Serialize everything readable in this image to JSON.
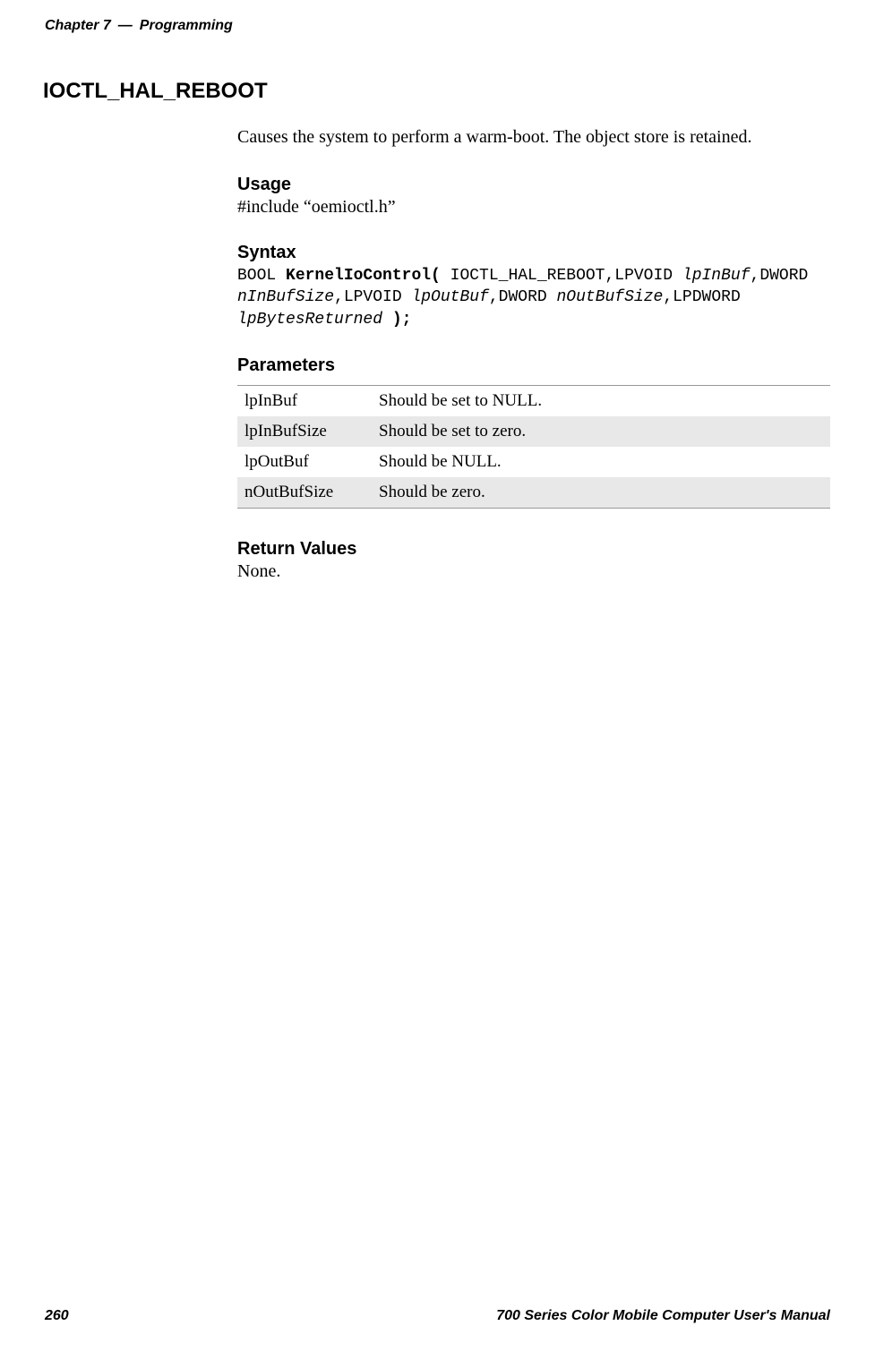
{
  "header": {
    "chapter_label": "Chapter 7",
    "separator": "—",
    "chapter_title": "Programming"
  },
  "section": {
    "title": "IOCTL_HAL_REBOOT",
    "description": "Causes the system to perform a warm-boot. The object store is retained."
  },
  "usage": {
    "heading": "Usage",
    "include_line": "#include “oemioctl.h”"
  },
  "syntax": {
    "heading": "Syntax",
    "type_prefix": "BOOL ",
    "func_open": "KernelIoControl(",
    "arg1_text": " IOCTL_HAL_REBOOT,LPVOID ",
    "arg2_italic": "lpInBuf",
    "arg3_text": ",DWORD ",
    "arg4_italic": "nInBufSize",
    "arg5_text": ",LPVOID ",
    "arg6_italic": "lpOutBuf",
    "arg7_text": ",DWORD ",
    "arg8_italic": "nOutBufSize",
    "arg9_text": ",LPDWORD ",
    "arg10_italic": "lpBytesReturned",
    "close_text": " );"
  },
  "parameters": {
    "heading": "Parameters",
    "rows": [
      {
        "name": "lpInBuf",
        "desc": "Should be set to NULL."
      },
      {
        "name": "lpInBufSize",
        "desc": "Should be set to zero."
      },
      {
        "name": "lpOutBuf",
        "desc": "Should be NULL."
      },
      {
        "name": "nOutBufSize",
        "desc": "Should be zero."
      }
    ]
  },
  "return_values": {
    "heading": "Return Values",
    "text": "None."
  },
  "footer": {
    "page_number": "260",
    "manual_title": "700 Series Color Mobile Computer User's Manual"
  }
}
